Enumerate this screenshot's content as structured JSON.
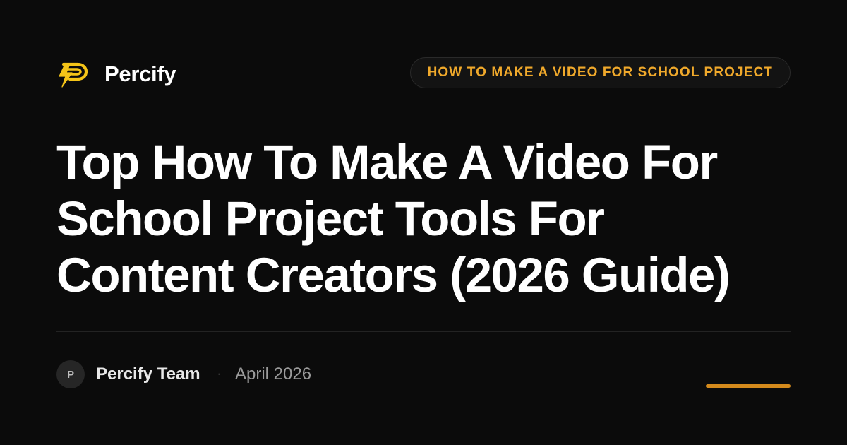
{
  "brand": {
    "name": "Percify",
    "logo_icon": "lightning-p-logo-icon"
  },
  "tag": {
    "label": "HOW TO MAKE A VIDEO FOR SCHOOL PROJECT"
  },
  "headline": {
    "lines": [
      "Top How To Make A Video For",
      "School Project Tools For",
      "Content Creators (2026 Guide)"
    ]
  },
  "byline": {
    "avatar_initial": "P",
    "author": "Percify Team",
    "separator": "·",
    "date": "April 2026"
  },
  "colors": {
    "background": "#0b0b0b",
    "accent": "#f0a92b",
    "accent_bar": "#d48a1c",
    "logo": "#f5c518",
    "text": "#ffffff",
    "muted_text": "#9a9a9a"
  }
}
